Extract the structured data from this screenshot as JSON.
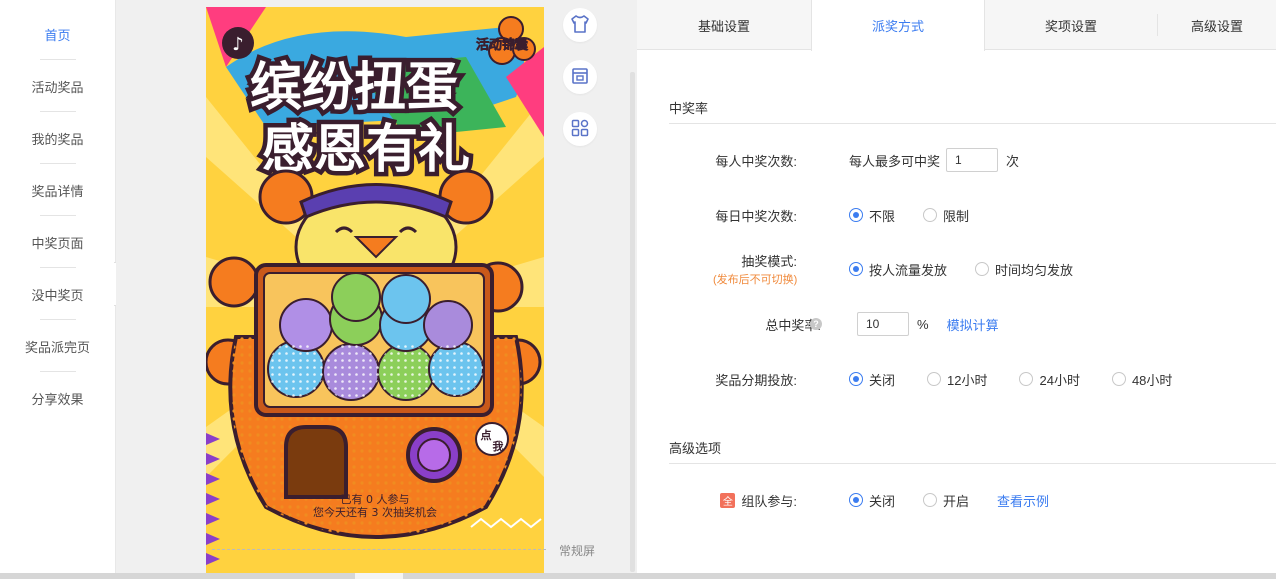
{
  "nav": {
    "items": [
      {
        "label": "首页",
        "active": true
      },
      {
        "label": "活动奖品"
      },
      {
        "label": "我的奖品"
      },
      {
        "label": "奖品详情"
      },
      {
        "label": "中奖页面"
      },
      {
        "label": "没中奖页"
      },
      {
        "label": "奖品派完页"
      },
      {
        "label": "分享效果"
      }
    ],
    "collapse_icon": "«"
  },
  "preview": {
    "title_line1": "缤纷扭蛋",
    "title_line2": "感恩有礼",
    "corner_badge": "活动锦囊",
    "tap_badge_1": "点",
    "tap_badge_2": "我",
    "participants": "已有 0 人参与",
    "chances": "您今天还有 3 次抽奖机会",
    "screen_label": "常规屏"
  },
  "tools": [
    {
      "icon": "shirt-icon"
    },
    {
      "icon": "store-icon"
    },
    {
      "icon": "grid-apps-icon"
    }
  ],
  "tabs": [
    "基础设置",
    "派奖方式",
    "奖项设置",
    "高级设置"
  ],
  "section1": {
    "title": "中奖率"
  },
  "rows": {
    "per_person": {
      "label": "每人中奖次数:",
      "prefix": "每人最多可中奖",
      "value": "1",
      "suffix": "次"
    },
    "daily": {
      "label": "每日中奖次数:",
      "options": [
        "不限",
        "限制"
      ],
      "selected": 0
    },
    "mode": {
      "label": "抽奖模式:",
      "note": "(发布后不可切换)",
      "options": [
        "按人流量发放",
        "时间均匀发放"
      ],
      "selected": 0
    },
    "rate": {
      "label": "总中奖率:",
      "help": "?",
      "value": "10",
      "unit": "%",
      "link": "模拟计算"
    },
    "stage": {
      "label": "奖品分期投放:",
      "options": [
        "关闭",
        "12小时",
        "24小时",
        "48小时"
      ],
      "selected": 0
    }
  },
  "section2": {
    "title": "高级选项"
  },
  "team": {
    "badge": "全",
    "label": "组队参与:",
    "options": [
      "关闭",
      "开启"
    ],
    "selected": 0,
    "link": "查看示例"
  },
  "colors": {
    "accent": "#3b7cf0",
    "note": "#f08a3c",
    "badge": "#f2715b"
  }
}
